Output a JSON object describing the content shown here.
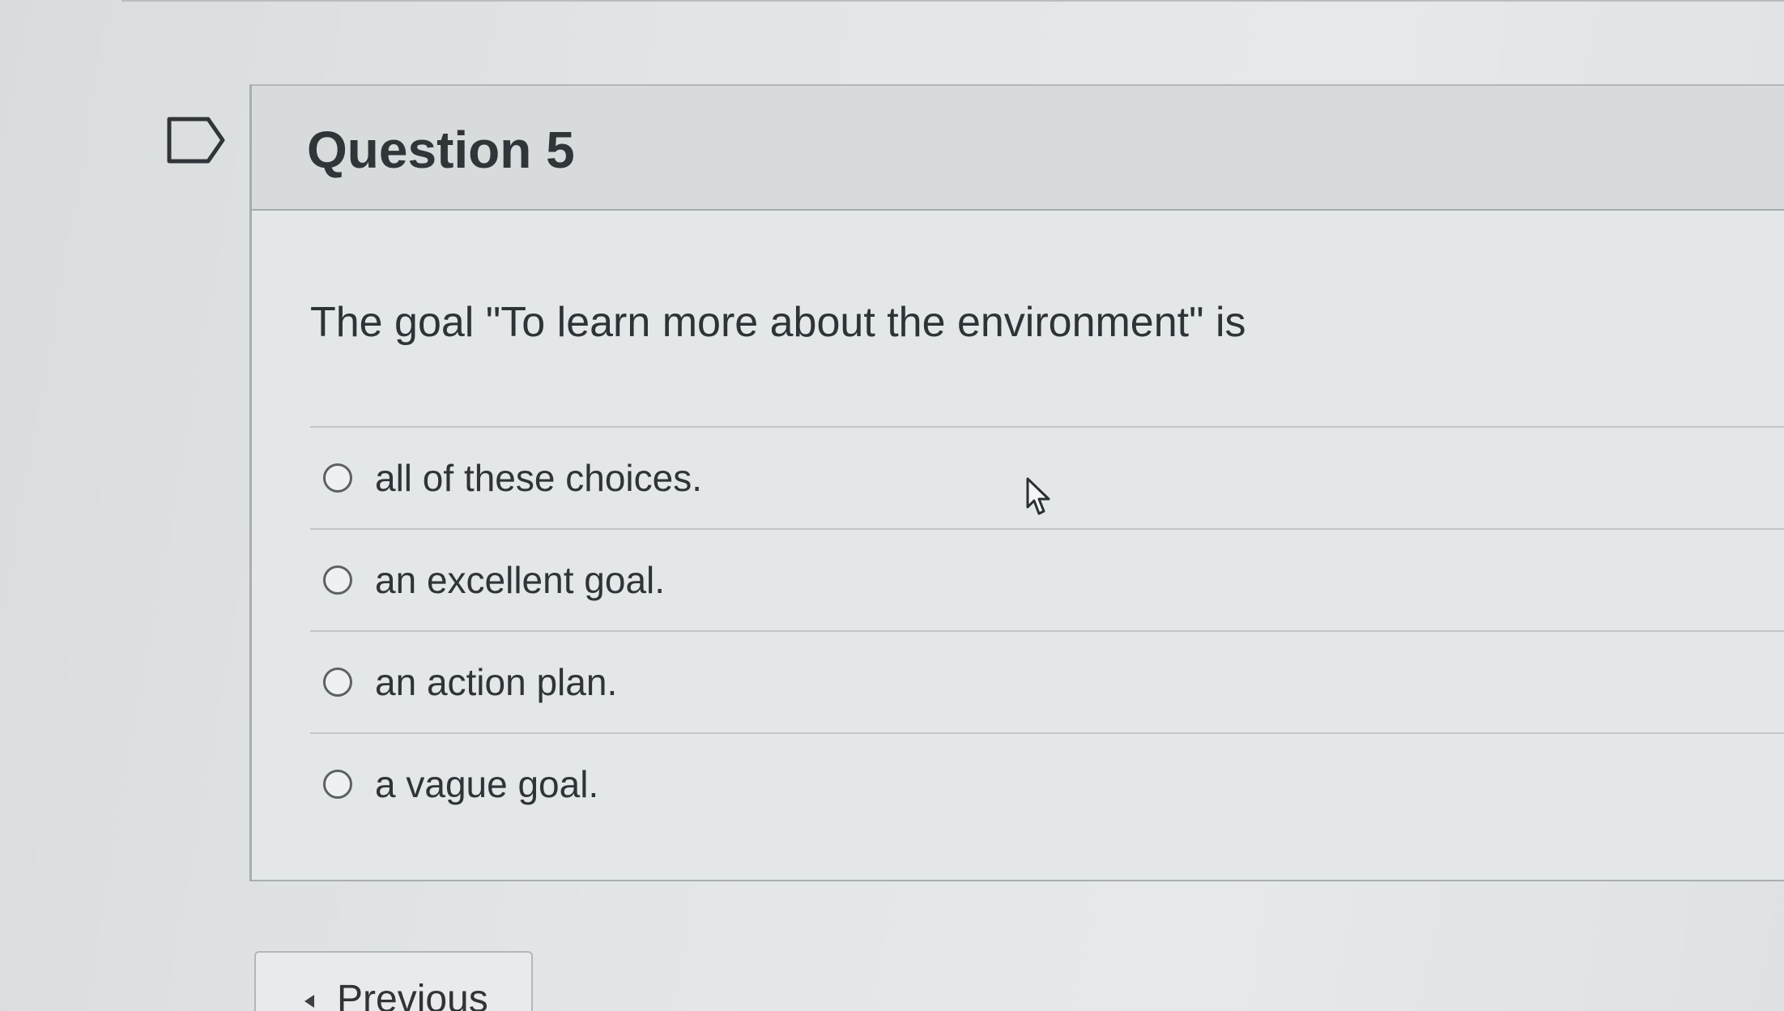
{
  "question": {
    "title": "Question 5",
    "prompt": "The goal \"To learn more about the environment\" is",
    "answers": [
      {
        "label": "all of these choices."
      },
      {
        "label": "an excellent goal."
      },
      {
        "label": "an action plan."
      },
      {
        "label": "a vague goal."
      }
    ]
  },
  "navigation": {
    "previous_label": "Previous"
  },
  "icons": {
    "flag": "flag-question-icon",
    "cursor": "mouse-pointer-icon",
    "previous": "caret-left-icon"
  }
}
